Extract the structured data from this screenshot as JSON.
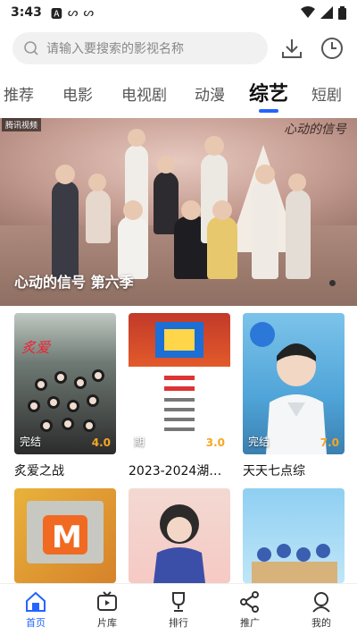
{
  "status_bar": {
    "time": "3:43",
    "icons": [
      "a-icon",
      "signal-icon",
      "signal-icon",
      "wifi-icon",
      "cell-icon",
      "battery-icon"
    ]
  },
  "search": {
    "placeholder": "请输入要搜索的影视名称"
  },
  "tabs": [
    {
      "label": "推荐"
    },
    {
      "label": "电影"
    },
    {
      "label": "电视剧"
    },
    {
      "label": "动漫"
    },
    {
      "label": "综艺",
      "active": true
    },
    {
      "label": "短剧"
    }
  ],
  "banner": {
    "caption": "心动的信号 第六季",
    "logo_top_right": "心动的信号",
    "logo_top_left": "腾讯视频"
  },
  "cards": [
    {
      "title": "炙爱之战",
      "status": "完结",
      "score": "4.0"
    },
    {
      "title": "2023-2024湖…",
      "status": "期",
      "score": "3.0"
    },
    {
      "title": "天天七点综",
      "status": "完结",
      "score": "7.0"
    }
  ],
  "bottom_nav": [
    {
      "label": "首页",
      "active": true
    },
    {
      "label": "片库"
    },
    {
      "label": "排行"
    },
    {
      "label": "推广"
    },
    {
      "label": "我的"
    }
  ],
  "colors": {
    "accent": "#2563ff",
    "score": "#f5a623"
  }
}
